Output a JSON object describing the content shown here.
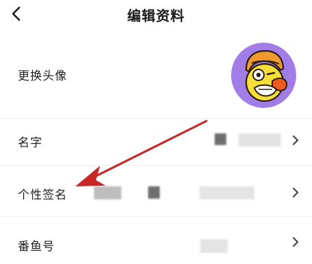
{
  "header": {
    "title": "编辑资料",
    "back_icon": "chevron-left-icon"
  },
  "profile": {
    "avatar_label": "更换头像",
    "avatar_icon": "cartoon-avatar-icon",
    "avatar_bg": "#a27de8"
  },
  "fields": [
    {
      "label": "名字",
      "value_state": "blurred"
    },
    {
      "label": "个性签名",
      "value_state": "blurred"
    },
    {
      "label": "番鱼号",
      "value_state": "blurred"
    }
  ],
  "annotation": {
    "arrow_color": "#c62828"
  }
}
